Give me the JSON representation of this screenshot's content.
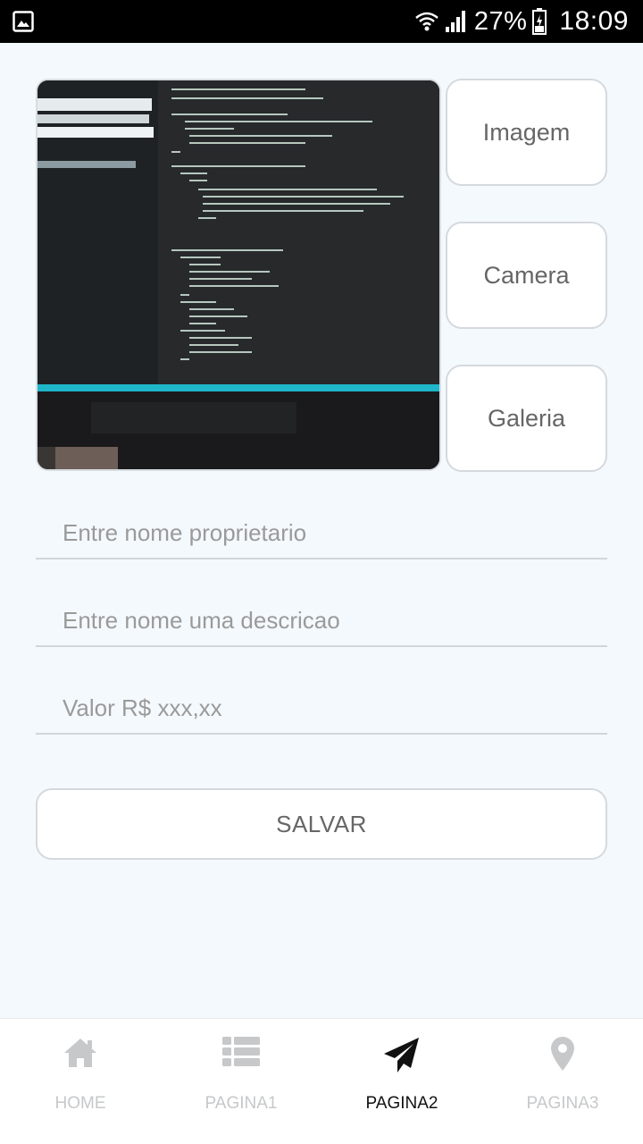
{
  "status_bar": {
    "battery": "27%",
    "time": "18:09",
    "icons": [
      "gallery-icon",
      "wifi-icon",
      "signal-icon",
      "battery-icon"
    ]
  },
  "media_buttons": {
    "imagem": "Imagem",
    "camera": "Camera",
    "galeria": "Galeria"
  },
  "form": {
    "owner_placeholder": "Entre nome proprietario",
    "description_placeholder": "Entre nome uma descricao",
    "value_placeholder": "Valor R$ xxx,xx",
    "save_label": "SALVAR"
  },
  "bottom_nav": {
    "tabs": [
      {
        "label": "HOME",
        "icon": "home-icon",
        "active": false
      },
      {
        "label": "PAGINA1",
        "icon": "list-icon",
        "active": false
      },
      {
        "label": "PAGINA2",
        "icon": "send-icon",
        "active": true
      },
      {
        "label": "PAGINA3",
        "icon": "map-marker-icon",
        "active": false
      }
    ]
  },
  "colors": {
    "background": "#f4f9fd",
    "active_tab": "#111111",
    "inactive_tab": "#c6c8ca",
    "accent_cyan": "#1fb6c9"
  }
}
